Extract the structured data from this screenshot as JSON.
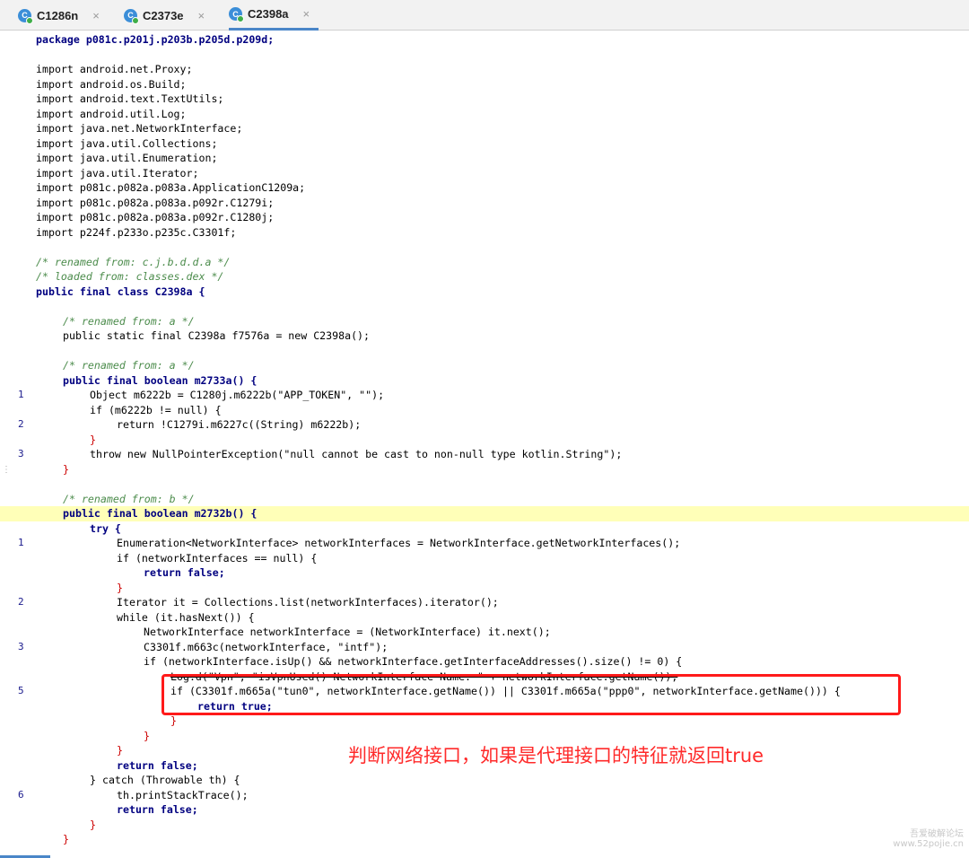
{
  "tabs": [
    {
      "label": "C1286n",
      "active": false
    },
    {
      "label": "C2373e",
      "active": false
    },
    {
      "label": "C2398a",
      "active": true
    }
  ],
  "tab_close_glyph": "×",
  "tab_icon_letter": "C",
  "annotation": "判断网络接口，如果是代理接口的特征就返回true",
  "watermark": "吾爱破解论坛",
  "watermark_url": "www.52pojie.cn",
  "code": {
    "line_1": "package p081c.p201j.p203b.p205d.p209d;",
    "imports": [
      "import android.net.Proxy;",
      "import android.os.Build;",
      "import android.text.TextUtils;",
      "import android.util.Log;",
      "import java.net.NetworkInterface;",
      "import java.util.Collections;",
      "import java.util.Enumeration;",
      "import java.util.Iterator;",
      "import p081c.p082a.p083a.ApplicationC1209a;",
      "import p081c.p082a.p083a.p092r.C1279i;",
      "import p081c.p082a.p083a.p092r.C1280j;",
      "import p224f.p233o.p235c.C3301f;"
    ],
    "comment_renamed": "/* renamed from: c.j.b.d.d.a */",
    "comment_loaded": "/* loaded from: classes.dex */",
    "class_decl": "public final class C2398a {",
    "comment_a1": "/* renamed from: a */",
    "field_decl": "public static final C2398a f7576a = new C2398a();",
    "comment_a2": "/* renamed from: a */",
    "method_a": "public final boolean m2733a() {",
    "a_l1": "Object m6222b = C1280j.m6222b(\"APP_TOKEN\", \"\");",
    "a_l2": "if (m6222b != null) {",
    "a_l3": "return !C1279i.m6227c((String) m6222b);",
    "a_l4": "}",
    "a_l5": "throw new NullPointerException(\"null cannot be cast to non-null type kotlin.String\");",
    "a_close": "}",
    "comment_b": "/* renamed from: b */",
    "method_b": "public final boolean m2732b() {",
    "b_try": "try {",
    "b_l1": "Enumeration<NetworkInterface> networkInterfaces = NetworkInterface.getNetworkInterfaces();",
    "b_l2": "if (networkInterfaces == null) {",
    "b_l3": "return false;",
    "b_l4": "}",
    "b_l5": "Iterator it = Collections.list(networkInterfaces).iterator();",
    "b_l6": "while (it.hasNext()) {",
    "b_l7": "NetworkInterface networkInterface = (NetworkInterface) it.next();",
    "b_l8": "C3301f.m663c(networkInterface, \"intf\");",
    "b_l9": "if (networkInterface.isUp() && networkInterface.getInterfaceAddresses().size() != 0) {",
    "b_l10": "Log.d(\"Vpn\", \"isVpnUsed() NetworkInterface Name: \" + networkInterface.getName());",
    "b_l11": "if (C3301f.m665a(\"tun0\", networkInterface.getName()) || C3301f.m665a(\"ppp0\", networkInterface.getName())) {",
    "b_l12": "return true;",
    "b_l13": "}",
    "b_l14": "}",
    "b_l15": "}",
    "b_l16": "return false;",
    "b_catch": "} catch (Throwable th) {",
    "b_l17": "th.printStackTrace();",
    "b_l18": "return false;",
    "b_l19": "}",
    "b_close": "}"
  },
  "line_numbers": {
    "a1": "1",
    "a2": "2",
    "a3": "3",
    "b1": "1",
    "b2": "2",
    "b3": "3",
    "b5": "5",
    "b6": "6"
  }
}
